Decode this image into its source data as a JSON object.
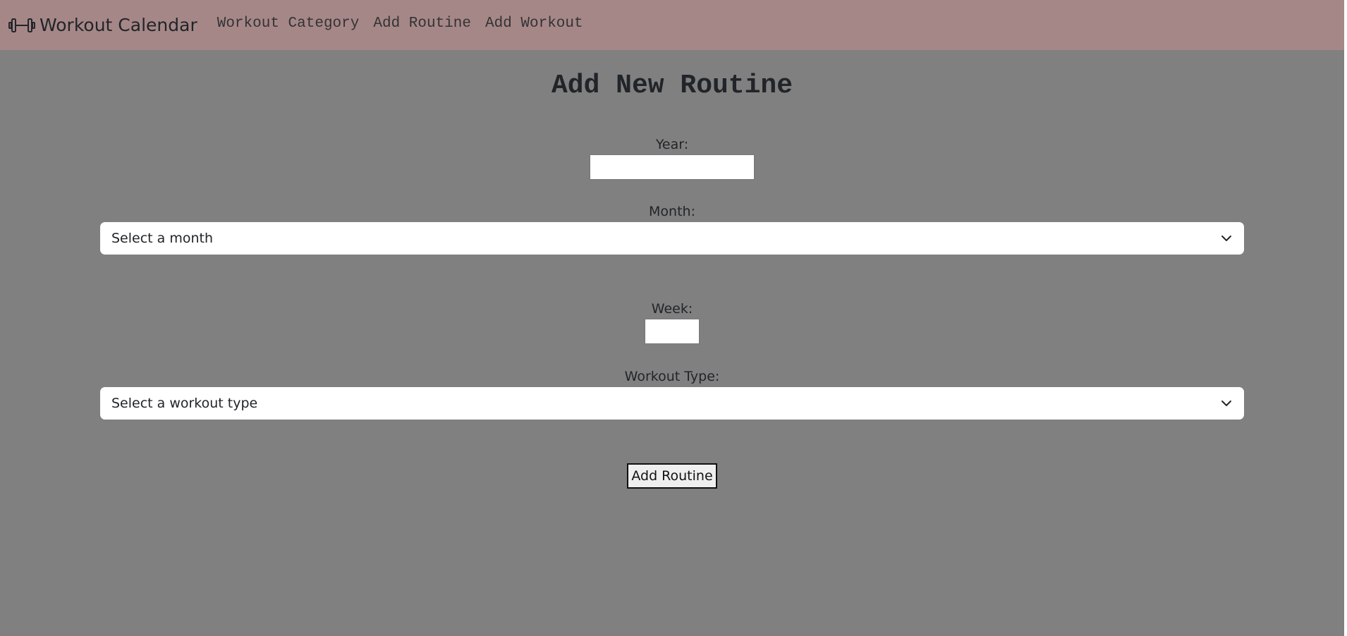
{
  "navbar": {
    "brand": "Workout Calendar",
    "brand_icon": "dumbbell-icon",
    "links": [
      "Workout Category",
      "Add Routine",
      "Add Workout"
    ]
  },
  "page": {
    "title": "Add New Routine"
  },
  "form": {
    "year_label": "Year:",
    "year_value": "",
    "month_label": "Month:",
    "month_selected": "Select a month",
    "week_label": "Week:",
    "week_value": "",
    "workout_type_label": "Workout Type:",
    "workout_type_selected": "Select a workout type",
    "submit_label": "Add Routine"
  },
  "colors": {
    "navbar_bg": "#a68788",
    "page_bg": "#808080"
  }
}
